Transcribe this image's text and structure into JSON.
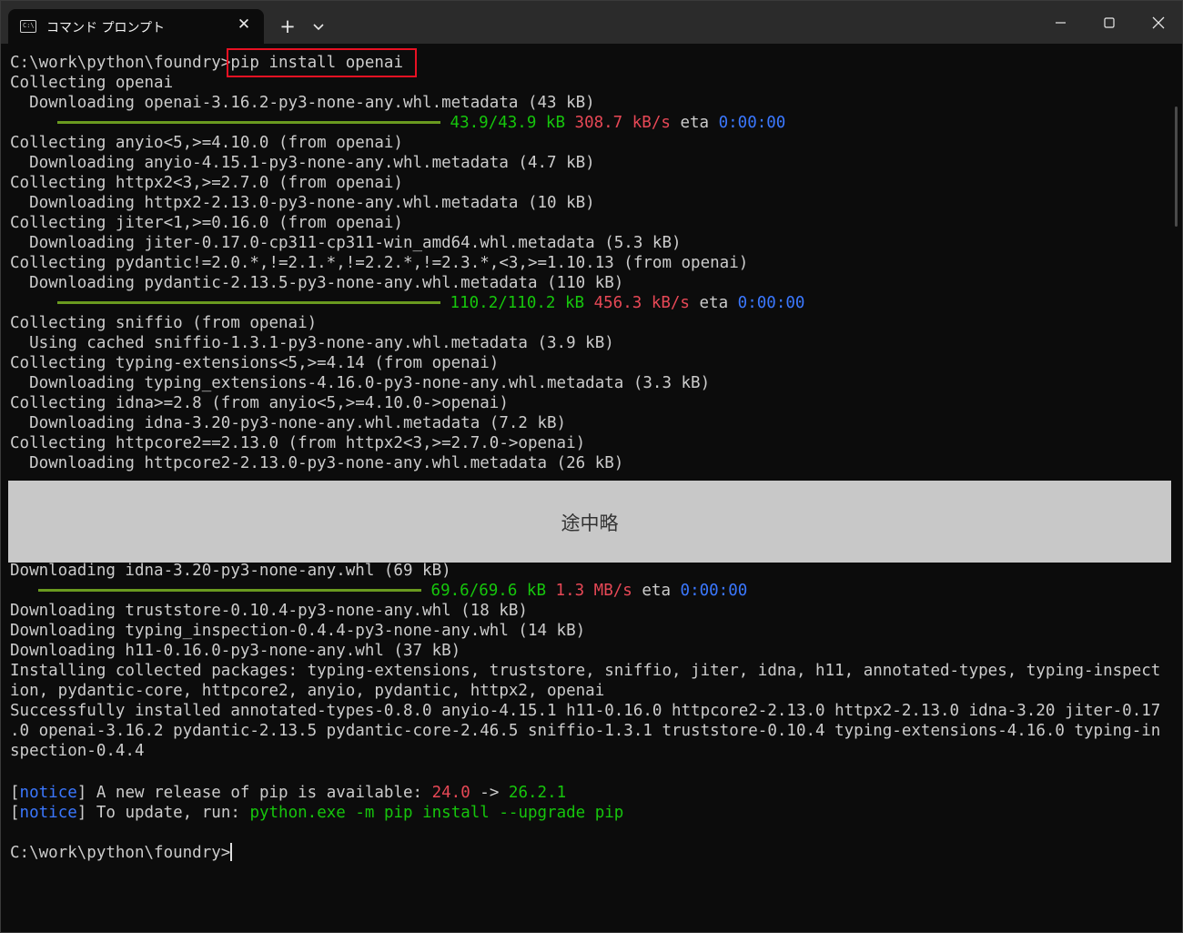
{
  "window": {
    "tab_title": "コマンド プロンプト",
    "tab_icon_text": "C:\\"
  },
  "terminal": {
    "prompt": "C:\\work\\python\\foundry>",
    "command": "pip install openai",
    "lines": [
      "Collecting openai",
      "  Downloading openai-3.16.2-py3-none-any.whl.metadata (43 kB)",
      "Collecting anyio<5,>=4.10.0 (from openai)",
      "  Downloading anyio-4.15.1-py3-none-any.whl.metadata (4.7 kB)",
      "Collecting httpx2<3,>=2.7.0 (from openai)",
      "  Downloading httpx2-2.13.0-py3-none-any.whl.metadata (10 kB)",
      "Collecting jiter<1,>=0.16.0 (from openai)",
      "  Downloading jiter-0.17.0-cp311-cp311-win_amd64.whl.metadata (5.3 kB)",
      "Collecting pydantic!=2.0.*,!=2.1.*,!=2.2.*,!=2.3.*,<3,>=1.10.13 (from openai)",
      "  Downloading pydantic-2.13.5-py3-none-any.whl.metadata (110 kB)",
      "Collecting sniffio (from openai)",
      "  Using cached sniffio-1.3.1-py3-none-any.whl.metadata (3.9 kB)",
      "Collecting typing-extensions<5,>=4.14 (from openai)",
      "  Downloading typing_extensions-4.16.0-py3-none-any.whl.metadata (3.3 kB)",
      "Collecting idna>=2.8 (from anyio<5,>=4.10.0->openai)",
      "  Downloading idna-3.20-py3-none-any.whl.metadata (7.2 kB)",
      "Collecting httpcore2==2.13.0 (from httpx2<3,>=2.7.0->openai)",
      "  Downloading httpcore2-2.13.0-py3-none-any.whl.metadata (26 kB)"
    ],
    "progress": [
      {
        "size": "43.9/43.9 kB",
        "speed": "308.7 kB/s",
        "eta_label": "eta",
        "eta": "0:00:00",
        "fraction": 1.0
      },
      {
        "size": "110.2/110.2 kB",
        "speed": "456.3 kB/s",
        "eta_label": "eta",
        "eta": "0:00:00",
        "fraction": 1.0
      },
      {
        "size": "69.6/69.6 kB",
        "speed": "1.3 MB/s",
        "eta_label": "eta",
        "eta": "0:00:00",
        "fraction": 1.0
      }
    ],
    "omitted_label": "途中略",
    "after_lines": [
      "Downloading idna-3.20-py3-none-any.whl (69 kB)",
      "Downloading truststore-0.10.4-py3-none-any.whl (18 kB)",
      "Downloading typing_inspection-0.4.4-py3-none-any.whl (14 kB)",
      "Downloading h11-0.16.0-py3-none-any.whl (37 kB)",
      "Installing collected packages: typing-extensions, truststore, sniffio, jiter, idna, h11, annotated-types, typing-inspect",
      "ion, pydantic-core, httpcore2, anyio, pydantic, httpx2, openai",
      "Successfully installed annotated-types-0.8.0 anyio-4.15.1 h11-0.16.0 httpcore2-2.13.0 httpx2-2.13.0 idna-3.20 jiter-0.17",
      ".0 openai-3.16.2 pydantic-2.13.5 pydantic-core-2.46.5 sniffio-1.3.1 truststore-0.10.4 typing-extensions-4.16.0 typing-in",
      "spection-0.4.4"
    ],
    "notice": {
      "tag": "notice",
      "line1_text": " A new release of pip is available: ",
      "old_version": "24.0",
      "arrow": " -> ",
      "new_version": "26.2.1",
      "line2_text": " To update, run: ",
      "update_command": "python.exe -m pip install --upgrade pip"
    },
    "final_prompt": "C:\\work\\python\\foundry>"
  },
  "colors": {
    "background": "#0c0c0c",
    "text": "#cccccc",
    "green": "#16c60c",
    "red": "#e74856",
    "blue": "#3b78ff",
    "highlight_box": "#e81123"
  }
}
